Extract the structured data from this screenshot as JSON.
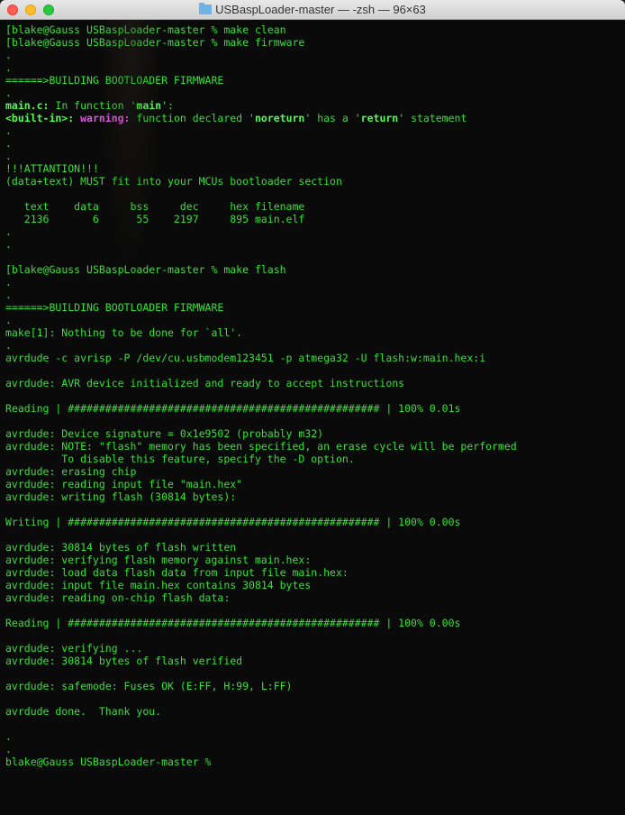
{
  "title_folder": "USBaspLoader-master",
  "title_rest": " — -zsh — 96×63",
  "lines": [
    {
      "segs": [
        {
          "t": "[",
          "c": "bracket"
        },
        {
          "t": "blake@Gauss USBaspLoader-master % make clean",
          "c": ""
        }
      ]
    },
    {
      "segs": [
        {
          "t": "[",
          "c": "bracket"
        },
        {
          "t": "blake@Gauss USBaspLoader-master % make firmware",
          "c": ""
        }
      ]
    },
    {
      "segs": [
        {
          "t": ".",
          "c": ""
        }
      ]
    },
    {
      "segs": [
        {
          "t": ".",
          "c": ""
        }
      ]
    },
    {
      "segs": [
        {
          "t": "======>BUILDING BOOTLOADER FIRMWARE",
          "c": ""
        }
      ]
    },
    {
      "segs": [
        {
          "t": ".",
          "c": ""
        }
      ]
    },
    {
      "segs": [
        {
          "t": "main.c:",
          "c": "bold"
        },
        {
          "t": " In function '",
          "c": ""
        },
        {
          "t": "main",
          "c": "bold"
        },
        {
          "t": "':",
          "c": ""
        }
      ]
    },
    {
      "segs": [
        {
          "t": "<built-in>: ",
          "c": "bold"
        },
        {
          "t": "warning: ",
          "c": "mag"
        },
        {
          "t": "function declared '",
          "c": ""
        },
        {
          "t": "noreturn",
          "c": "bold"
        },
        {
          "t": "' has a '",
          "c": ""
        },
        {
          "t": "return",
          "c": "bold"
        },
        {
          "t": "' statement",
          "c": ""
        }
      ]
    },
    {
      "segs": [
        {
          "t": ".",
          "c": ""
        }
      ]
    },
    {
      "segs": [
        {
          "t": ".",
          "c": ""
        }
      ]
    },
    {
      "segs": [
        {
          "t": ".",
          "c": ""
        }
      ]
    },
    {
      "segs": [
        {
          "t": "!!!ATTANTION!!!",
          "c": ""
        }
      ]
    },
    {
      "segs": [
        {
          "t": "(data+text) MUST fit into your MCUs bootloader section",
          "c": ""
        }
      ]
    },
    {
      "segs": [
        {
          "t": "",
          "c": ""
        }
      ]
    },
    {
      "segs": [
        {
          "t": "   text    data     bss     dec     hex filename",
          "c": ""
        }
      ]
    },
    {
      "segs": [
        {
          "t": "   2136       6      55    2197     895 main.elf",
          "c": ""
        }
      ]
    },
    {
      "segs": [
        {
          "t": ".",
          "c": ""
        }
      ]
    },
    {
      "segs": [
        {
          "t": ".",
          "c": ""
        }
      ]
    },
    {
      "segs": [
        {
          "t": "",
          "c": ""
        }
      ]
    },
    {
      "segs": [
        {
          "t": "[",
          "c": "bracket"
        },
        {
          "t": "blake@Gauss USBaspLoader-master % make flash",
          "c": ""
        }
      ]
    },
    {
      "segs": [
        {
          "t": ".",
          "c": ""
        }
      ]
    },
    {
      "segs": [
        {
          "t": ".",
          "c": ""
        }
      ]
    },
    {
      "segs": [
        {
          "t": "======>BUILDING BOOTLOADER FIRMWARE",
          "c": ""
        }
      ]
    },
    {
      "segs": [
        {
          "t": ".",
          "c": ""
        }
      ]
    },
    {
      "segs": [
        {
          "t": "make[1]: Nothing to be done for `all'.",
          "c": ""
        }
      ]
    },
    {
      "segs": [
        {
          "t": ".",
          "c": ""
        }
      ]
    },
    {
      "segs": [
        {
          "t": "avrdude -c avrisp -P /dev/cu.usbmodem123451 -p atmega32 -U flash:w:main.hex:i",
          "c": ""
        }
      ]
    },
    {
      "segs": [
        {
          "t": "",
          "c": ""
        }
      ]
    },
    {
      "segs": [
        {
          "t": "avrdude: AVR device initialized and ready to accept instructions",
          "c": ""
        }
      ]
    },
    {
      "segs": [
        {
          "t": "",
          "c": ""
        }
      ]
    },
    {
      "segs": [
        {
          "t": "Reading | ################################################## | 100% 0.01s",
          "c": ""
        }
      ]
    },
    {
      "segs": [
        {
          "t": "",
          "c": ""
        }
      ]
    },
    {
      "segs": [
        {
          "t": "avrdude: Device signature = 0x1e9502 (probably m32)",
          "c": ""
        }
      ]
    },
    {
      "segs": [
        {
          "t": "avrdude: NOTE: \"flash\" memory has been specified, an erase cycle will be performed",
          "c": ""
        }
      ]
    },
    {
      "segs": [
        {
          "t": "         To disable this feature, specify the -D option.",
          "c": ""
        }
      ]
    },
    {
      "segs": [
        {
          "t": "avrdude: erasing chip",
          "c": ""
        }
      ]
    },
    {
      "segs": [
        {
          "t": "avrdude: reading input file \"main.hex\"",
          "c": ""
        }
      ]
    },
    {
      "segs": [
        {
          "t": "avrdude: writing flash (30814 bytes):",
          "c": ""
        }
      ]
    },
    {
      "segs": [
        {
          "t": "",
          "c": ""
        }
      ]
    },
    {
      "segs": [
        {
          "t": "Writing | ################################################## | 100% 0.00s",
          "c": ""
        }
      ]
    },
    {
      "segs": [
        {
          "t": "",
          "c": ""
        }
      ]
    },
    {
      "segs": [
        {
          "t": "avrdude: 30814 bytes of flash written",
          "c": ""
        }
      ]
    },
    {
      "segs": [
        {
          "t": "avrdude: verifying flash memory against main.hex:",
          "c": ""
        }
      ]
    },
    {
      "segs": [
        {
          "t": "avrdude: load data flash data from input file main.hex:",
          "c": ""
        }
      ]
    },
    {
      "segs": [
        {
          "t": "avrdude: input file main.hex contains 30814 bytes",
          "c": ""
        }
      ]
    },
    {
      "segs": [
        {
          "t": "avrdude: reading on-chip flash data:",
          "c": ""
        }
      ]
    },
    {
      "segs": [
        {
          "t": "",
          "c": ""
        }
      ]
    },
    {
      "segs": [
        {
          "t": "Reading | ################################################## | 100% 0.00s",
          "c": ""
        }
      ]
    },
    {
      "segs": [
        {
          "t": "",
          "c": ""
        }
      ]
    },
    {
      "segs": [
        {
          "t": "avrdude: verifying ...",
          "c": ""
        }
      ]
    },
    {
      "segs": [
        {
          "t": "avrdude: 30814 bytes of flash verified",
          "c": ""
        }
      ]
    },
    {
      "segs": [
        {
          "t": "",
          "c": ""
        }
      ]
    },
    {
      "segs": [
        {
          "t": "avrdude: safemode: Fuses OK (E:FF, H:99, L:FF)",
          "c": ""
        }
      ]
    },
    {
      "segs": [
        {
          "t": "",
          "c": ""
        }
      ]
    },
    {
      "segs": [
        {
          "t": "avrdude done.  Thank you.",
          "c": ""
        }
      ]
    },
    {
      "segs": [
        {
          "t": "",
          "c": ""
        }
      ]
    },
    {
      "segs": [
        {
          "t": ".",
          "c": ""
        }
      ]
    },
    {
      "segs": [
        {
          "t": ".",
          "c": ""
        }
      ]
    },
    {
      "segs": [
        {
          "t": "blake@Gauss USBaspLoader-master % ",
          "c": ""
        }
      ]
    }
  ]
}
